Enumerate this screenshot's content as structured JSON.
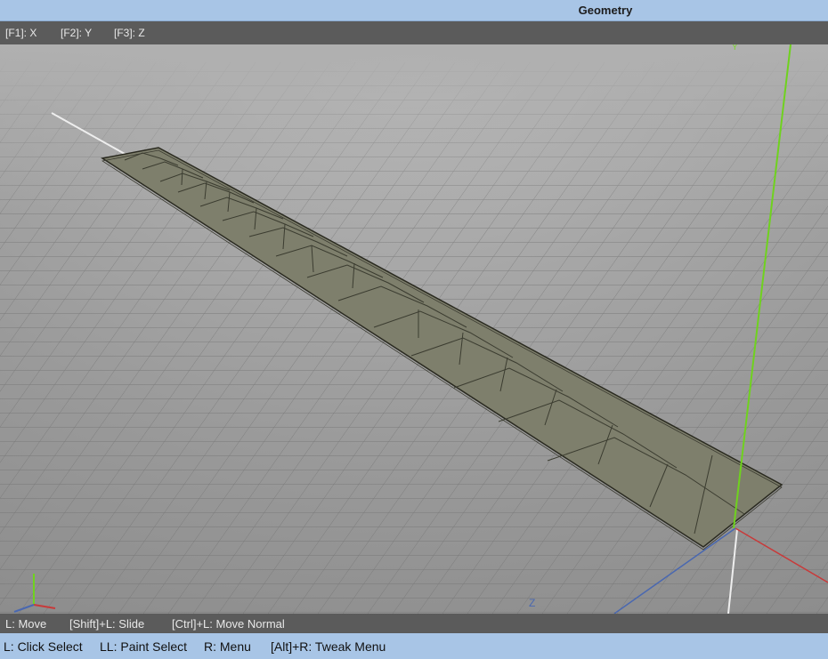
{
  "window": {
    "title": "Geometry"
  },
  "hotkeys": {
    "x": "[F1]: X",
    "y": "[F2]: Y",
    "z": "[F3]: Z"
  },
  "viewport": {
    "axis_label_y": "Y",
    "axis_label_z": "Z",
    "colors": {
      "background": "#8f8f8f",
      "grid": "#6e6e6e",
      "mesh": "#7e7f6c",
      "y_axis": "#6fd21e",
      "x_axis": "#c83a3a",
      "z_axis": "#4a68b0"
    }
  },
  "status_bar": {
    "move": "L: Move",
    "slide": "[Shift]+L: Slide",
    "move_normal": "[Ctrl]+L: Move Normal"
  },
  "help_bar": {
    "click_select": "L: Click Select",
    "paint_select": "LL: Paint Select",
    "menu": "R: Menu",
    "tweak_menu": "[Alt]+R: Tweak Menu"
  }
}
